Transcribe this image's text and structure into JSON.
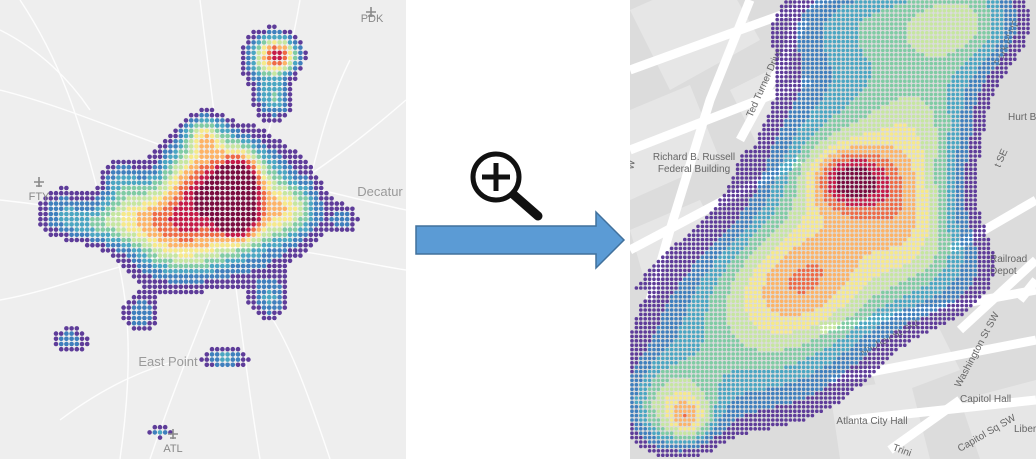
{
  "left_map": {
    "background": "#eeeeee",
    "labels": {
      "pdk": "PDK",
      "fty": "FTY",
      "decatur": "Decatur",
      "east_point": "East Point",
      "atl": "ATL"
    }
  },
  "right_map": {
    "background": "#dcdcdc",
    "streets": {
      "ted_turner": "Ted Turner Drive",
      "russell_1": "Richard B. Russell",
      "russell_2": "Federal Building",
      "city_hall": "Atlanta City Hall",
      "mitchell": "Mitchell St SW",
      "washington": "Washington St SW",
      "capitol_sq": "Capitol Sq SW",
      "capitol_hall": "Capitol Hall",
      "railroad_1": "Railroad",
      "railroad_2": "Depot",
      "park_pl": "Park Pl NE",
      "hurt": "Hurt B",
      "se": "t SE",
      "sw_left": "W",
      "trinity": "Trini",
      "liberty": "Liberty"
    }
  },
  "zoom_icon": "zoom-in-magnifier-icon",
  "arrow_color": "#5b9bd5",
  "heat_colors": [
    "#5e3c99",
    "#3f7fbd",
    "#4aa6c2",
    "#7fcba4",
    "#c6e6a0",
    "#f6e98a",
    "#fdb366",
    "#ef6a45",
    "#c51b48",
    "#7a0c3f"
  ]
}
